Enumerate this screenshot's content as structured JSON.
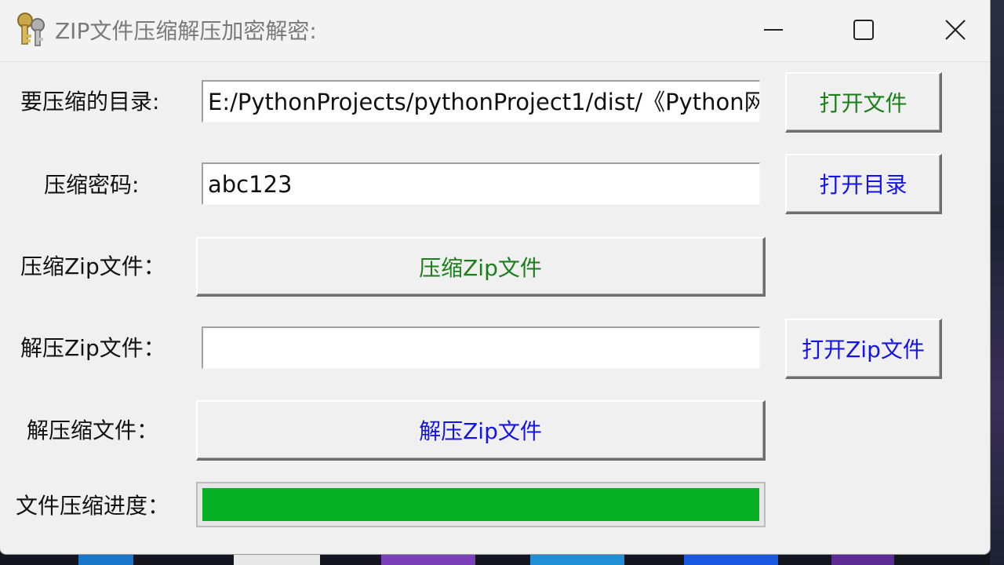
{
  "window": {
    "title": "ZIP文件压缩解压加密解密:"
  },
  "form": {
    "compress_dir": {
      "label": "要压缩的目录:",
      "value": "E:/PythonProjects/pythonProject1/dist/《Python网"
    },
    "compress_password": {
      "label": "压缩密码:",
      "value": "abc123"
    },
    "compress_zip": {
      "label": "压缩Zip文件：",
      "button": "压缩Zip文件"
    },
    "extract_zip": {
      "label": "解压Zip文件：",
      "value": "",
      "open_button": "打开Zip文件"
    },
    "extract_file": {
      "label": "解压缩文件：",
      "button": "解压Zip文件"
    },
    "progress": {
      "label": "文件压缩进度：",
      "value": 1.0
    }
  },
  "buttons": {
    "open_file": "打开文件",
    "open_dir": "打开目录"
  },
  "colors": {
    "green_text": "#1a7f1a",
    "blue_text": "#1414e6",
    "progress_fill": "#06b025",
    "window_bg": "#f0f0f0"
  },
  "icons": {
    "app": "keys-icon",
    "minimize": "minimize-icon",
    "maximize": "maximize-icon",
    "close": "close-icon"
  }
}
